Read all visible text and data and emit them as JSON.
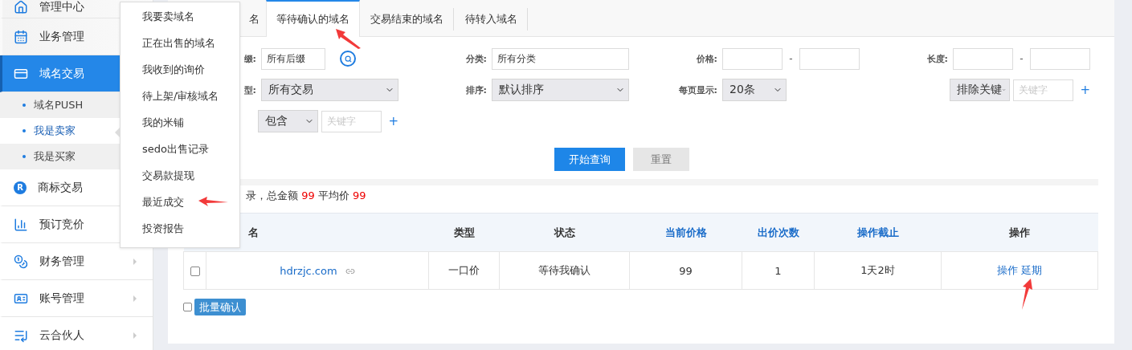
{
  "sidebar": {
    "items": [
      {
        "label": "管理中心",
        "selected": false,
        "has_arrow": false
      },
      {
        "label": "业务管理",
        "selected": false,
        "has_arrow": false
      },
      {
        "label": "域名交易",
        "selected": true,
        "has_arrow": false,
        "children": [
          {
            "label": "域名PUSH",
            "selected": false
          },
          {
            "label": "我是卖家",
            "selected": true
          },
          {
            "label": "我是买家",
            "selected": false
          }
        ]
      },
      {
        "label": "商标交易",
        "selected": false,
        "has_arrow": false,
        "icon_text": "R"
      },
      {
        "label": "预订竞价",
        "selected": false,
        "has_arrow": false
      },
      {
        "label": "财务管理",
        "selected": false,
        "has_arrow": true
      },
      {
        "label": "账号管理",
        "selected": false,
        "has_arrow": true
      },
      {
        "label": "云合伙人",
        "selected": false,
        "has_arrow": true
      }
    ]
  },
  "popup_menu": {
    "items": [
      "我要卖域名",
      "正在出售的域名",
      "我收到的询价",
      "待上架/审核域名",
      "我的米铺",
      "sedo出售记录",
      "交易款提现",
      "最近成交",
      "投资报告"
    ]
  },
  "tabs": [
    {
      "label": "名",
      "selected": false
    },
    {
      "label": "等待确认的域名",
      "selected": true
    },
    {
      "label": "交易结束的域名",
      "selected": false
    },
    {
      "label": "待转入域名",
      "selected": false
    }
  ],
  "filters": [
    [
      {
        "label": "缀:",
        "controls": [
          {
            "kind": "input",
            "value": "所有后缀"
          },
          {
            "kind": "search"
          }
        ]
      },
      {
        "label": "分类:",
        "controls": [
          {
            "kind": "wide-input",
            "value": "所有分类"
          }
        ]
      },
      {
        "label": "价格:",
        "controls": [
          {
            "kind": "input"
          },
          {
            "kind": "dash",
            "text": "-"
          },
          {
            "kind": "input"
          }
        ]
      },
      {
        "label": "长度:",
        "controls": [
          {
            "kind": "input"
          },
          {
            "kind": "dash",
            "text": "-"
          },
          {
            "kind": "input"
          }
        ]
      }
    ],
    [
      {
        "label": "型:",
        "controls": [
          {
            "kind": "wide-select",
            "value": "所有交易"
          }
        ]
      },
      {
        "label": "排序:",
        "controls": [
          {
            "kind": "wide-select",
            "value": "默认排序"
          }
        ]
      },
      {
        "label": "每页显示:",
        "controls": [
          {
            "kind": "select",
            "value": "20条"
          }
        ]
      },
      {
        "controls": [
          {
            "kind": "select",
            "value": "排除关键"
          },
          {
            "kind": "input",
            "placeholder": "关键字"
          },
          {
            "kind": "plus",
            "text": "+"
          }
        ]
      }
    ],
    [
      {
        "controls": [
          {
            "kind": "select",
            "value": "包含"
          },
          {
            "kind": "input",
            "placeholder": "关键字"
          },
          {
            "kind": "plus",
            "text": "+"
          }
        ]
      }
    ]
  ],
  "buttons": [
    {
      "label": "开始查询",
      "kind": "primary"
    },
    {
      "label": "重置",
      "kind": "secondary"
    }
  ],
  "summary": [
    {
      "text": "录，总金额 ",
      "highlight": false
    },
    {
      "text": "99",
      "highlight": true
    },
    {
      "text": " 平均价 ",
      "highlight": false
    },
    {
      "text": "99",
      "highlight": true
    }
  ],
  "table": {
    "columns": [
      {
        "label": "名",
        "sortable": false
      },
      {
        "label": "类型",
        "sortable": false
      },
      {
        "label": "状态",
        "sortable": false
      },
      {
        "label": "当前价格",
        "sortable": true
      },
      {
        "label": "出价次数",
        "sortable": true
      },
      {
        "label": "操作截止",
        "sortable": true
      },
      {
        "label": "操作",
        "sortable": false
      }
    ],
    "rows": [
      {
        "checked": false,
        "cells": [
          "hdrzjc.com",
          "一口价",
          "等待我确认",
          "99",
          "1",
          "1天2时"
        ],
        "actions": [
          "操作",
          "延期"
        ]
      }
    ]
  },
  "batch": {
    "checked": false,
    "label": "批量确认"
  }
}
